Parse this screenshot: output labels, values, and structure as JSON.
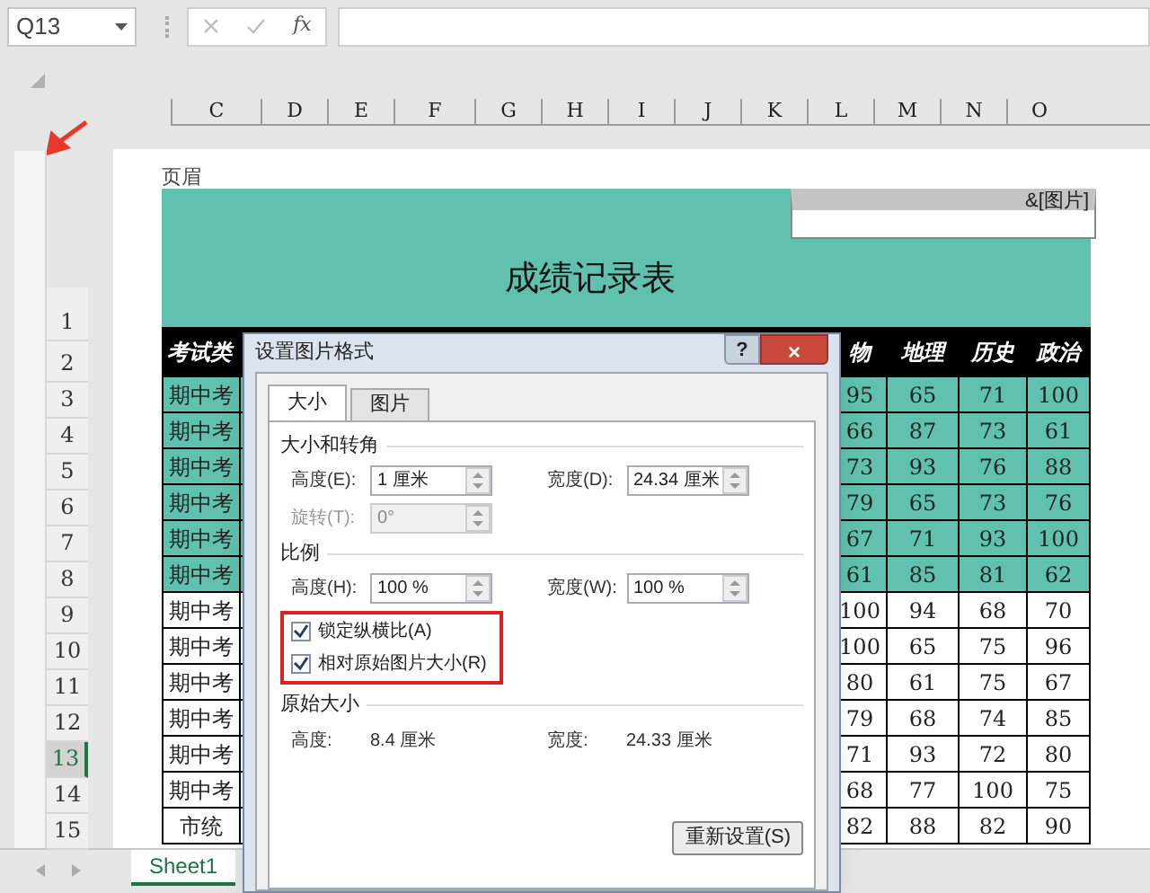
{
  "name_box": {
    "value": "Q13"
  },
  "formula_bar": {
    "function_label": "fx"
  },
  "column_headers": [
    "C",
    "D",
    "E",
    "F",
    "G",
    "H",
    "I",
    "J",
    "K",
    "L",
    "M",
    "N",
    "O"
  ],
  "row_headers": [
    {
      "label": "1",
      "selected": false
    },
    {
      "label": "2",
      "selected": false
    },
    {
      "label": "3",
      "selected": false
    },
    {
      "label": "4",
      "selected": false
    },
    {
      "label": "5",
      "selected": false
    },
    {
      "label": "6",
      "selected": false
    },
    {
      "label": "7",
      "selected": false
    },
    {
      "label": "8",
      "selected": false
    },
    {
      "label": "9",
      "selected": false
    },
    {
      "label": "10",
      "selected": false
    },
    {
      "label": "11",
      "selected": false
    },
    {
      "label": "12",
      "selected": false
    },
    {
      "label": "13",
      "selected": true
    },
    {
      "label": "14",
      "selected": false
    },
    {
      "label": "15",
      "selected": false
    }
  ],
  "page": {
    "header_label": "页眉",
    "header_field": "&[图片]",
    "title": "成绩记录表",
    "table": {
      "columns": [
        "考试类",
        "物",
        "地理",
        "历史",
        "政治"
      ],
      "rows": [
        {
          "highlighted": true,
          "cells": [
            "期中考",
            "95",
            "65",
            "71",
            "100"
          ]
        },
        {
          "highlighted": true,
          "cells": [
            "期中考",
            "66",
            "87",
            "73",
            "61"
          ]
        },
        {
          "highlighted": true,
          "cells": [
            "期中考",
            "73",
            "93",
            "76",
            "88"
          ]
        },
        {
          "highlighted": true,
          "cells": [
            "期中考",
            "79",
            "65",
            "73",
            "76"
          ]
        },
        {
          "highlighted": true,
          "cells": [
            "期中考",
            "67",
            "71",
            "93",
            "100"
          ]
        },
        {
          "highlighted": true,
          "cells": [
            "期中考",
            "61",
            "85",
            "81",
            "62"
          ]
        },
        {
          "highlighted": false,
          "cells": [
            "期中考",
            "100",
            "94",
            "68",
            "70"
          ]
        },
        {
          "highlighted": false,
          "cells": [
            "期中考",
            "100",
            "65",
            "75",
            "96"
          ]
        },
        {
          "highlighted": false,
          "cells": [
            "期中考",
            "80",
            "61",
            "75",
            "67"
          ]
        },
        {
          "highlighted": false,
          "cells": [
            "期中考",
            "79",
            "68",
            "74",
            "85"
          ]
        },
        {
          "highlighted": false,
          "cells": [
            "期中考",
            "71",
            "93",
            "72",
            "80"
          ]
        },
        {
          "highlighted": false,
          "cells": [
            "期中考",
            "68",
            "77",
            "100",
            "75"
          ]
        },
        {
          "highlighted": false,
          "cells": [
            "市统",
            "82",
            "88",
            "82",
            "90"
          ]
        }
      ]
    }
  },
  "dialog": {
    "title": "设置图片格式",
    "help_glyph": "?",
    "close_glyph": "×",
    "tabs": [
      {
        "label": "大小",
        "selected": true
      },
      {
        "label": "图片",
        "selected": false
      }
    ],
    "size_rotate": {
      "heading": "大小和转角",
      "height": {
        "label": "高度(E):",
        "value": "1 厘米"
      },
      "width": {
        "label": "宽度(D):",
        "value": "24.34 厘米"
      },
      "rotation": {
        "label": "旋转(T):",
        "value": "0°",
        "disabled": true
      }
    },
    "scale": {
      "heading": "比例",
      "height": {
        "label": "高度(H):",
        "value": "100 %"
      },
      "width": {
        "label": "宽度(W):",
        "value": "100 %"
      },
      "options": [
        {
          "label": "锁定纵横比(A)",
          "checked": true
        },
        {
          "label": "相对原始图片大小(R)",
          "checked": true
        }
      ]
    },
    "original_size": {
      "heading": "原始大小",
      "height": {
        "label": "高度:",
        "value": "8.4 厘米"
      },
      "width": {
        "label": "宽度:",
        "value": "24.33 厘米"
      }
    },
    "reset_button": "重新设置(S)"
  },
  "sheet_tabs": [
    {
      "label": "Sheet1",
      "selected": true
    }
  ]
}
